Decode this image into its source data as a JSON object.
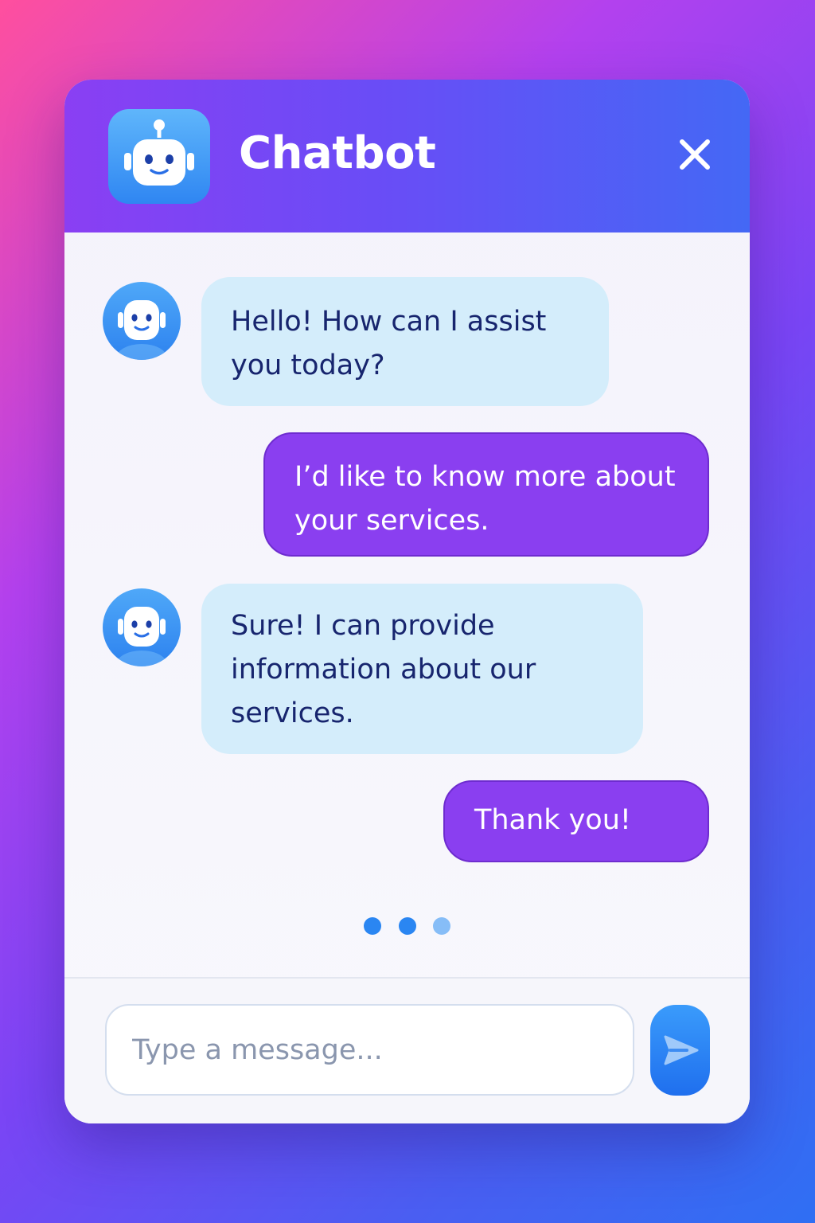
{
  "header": {
    "title": "Chatbot",
    "app_icon": "robot-icon",
    "close_icon": "close-icon"
  },
  "messages": [
    {
      "sender": "bot",
      "avatar_icon": "robot-icon",
      "text": "Hello! How can I assist you today?"
    },
    {
      "sender": "user",
      "text": "I’d like to know more about your services."
    },
    {
      "sender": "bot",
      "avatar_icon": "robot-icon",
      "text": "Sure! I can provide information about our services."
    },
    {
      "sender": "user",
      "text": "Thank you!"
    }
  ],
  "typing_indicator": {
    "dots": 3
  },
  "composer": {
    "placeholder": "Type a message...",
    "value": "",
    "send_icon": "send-icon"
  },
  "colors": {
    "header_start": "#8a3ff3",
    "header_end": "#4468f5",
    "bot_bubble": "#d4edfb",
    "bot_text": "#17256e",
    "user_bubble": "#8a3ff0",
    "user_text": "#ffffff",
    "send_button": "#1f6fee"
  }
}
